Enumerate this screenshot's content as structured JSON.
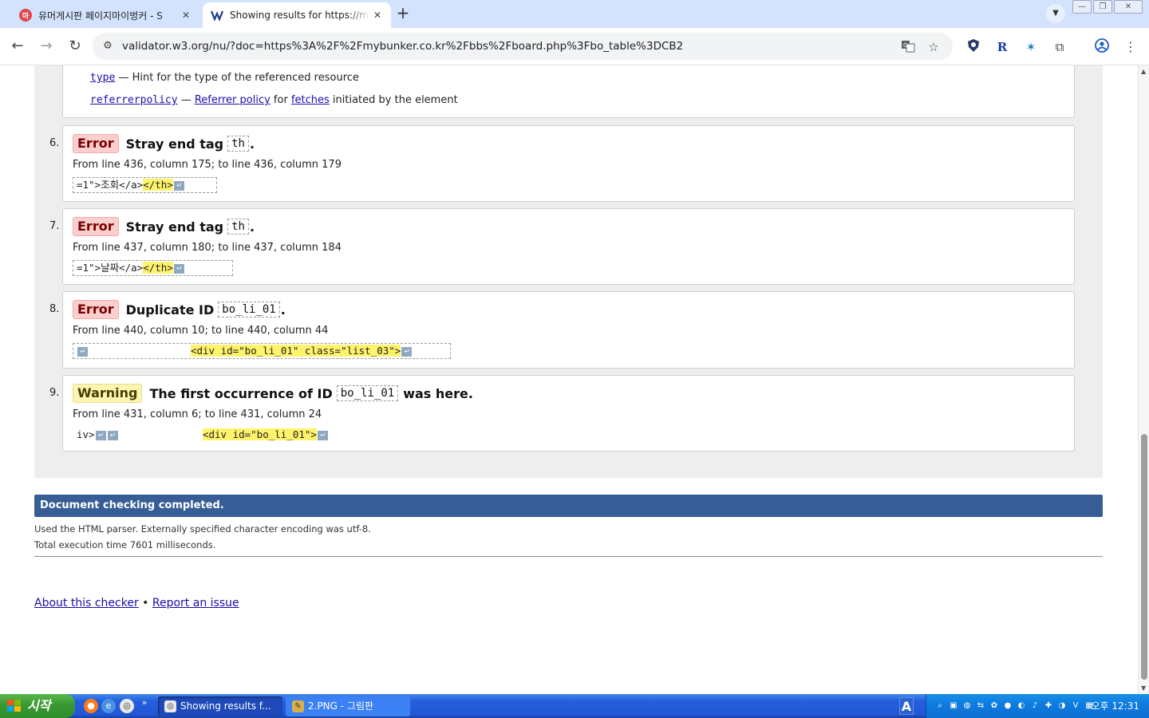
{
  "browser": {
    "tabs": [
      {
        "title": "유머게시판 페이지마이벙커 - S",
        "favicon": "마"
      },
      {
        "title": "Showing results for https://my",
        "favicon": "W3"
      }
    ],
    "url": "validator.w3.org/nu/?doc=https%3A%2F%2Fmybunker.co.kr%2Fbbs%2Fboard.php%3Fbo_table%3DCB2"
  },
  "partial_message": {
    "attr_type": "type",
    "attr_type_desc": " — Hint for the type of the referenced resource",
    "attr_referrerpolicy": "referrerpolicy",
    "dash": " — ",
    "referrer_policy_link": "Referrer policy",
    "for": " for ",
    "fetches_link": "fetches",
    "tail": " initiated by the element"
  },
  "messages": [
    {
      "num": "6.",
      "type": "Error",
      "text": "Stray end tag",
      "code": "th",
      "after": ".",
      "location": "From line 436, column 175; to line 436, column 179",
      "extract_pre": "=1\">조회</a>",
      "extract_hl": "</th>",
      "extract_post": "",
      "lf_symbol": "↩"
    },
    {
      "num": "7.",
      "type": "Error",
      "text": "Stray end tag",
      "code": "th",
      "after": ".",
      "location": "From line 437, column 180; to line 437, column 184",
      "extract_pre": "=1\">날짜</a>",
      "extract_hl": "</th>",
      "extract_post": "",
      "lf_symbol": "↩"
    },
    {
      "num": "8.",
      "type": "Error",
      "text": "Duplicate ID",
      "code": "bo_li_01",
      "after": ".",
      "location": "From line 440, column 10; to line 440, column 44",
      "extract_pre": "                 ",
      "extract_hl": "<div id=\"bo_li_01\" class=\"list_03\">",
      "extract_post": "",
      "lf_symbol": "↩"
    },
    {
      "num": "9.",
      "type": "Warning",
      "text": "The first occurrence of ID",
      "code": "bo_li_01",
      "after": "was here.",
      "location": "From line 431, column 6; to line 431, column 24",
      "extract_pre": "iv>",
      "extract_hl": "<div id=\"bo_li_01\">",
      "extract_post": "",
      "lf_symbol": "↩"
    }
  ],
  "completion": {
    "title": "Document checking completed.",
    "parser_note": "Used the HTML parser. Externally specified character encoding was utf-8.",
    "exec_time": "Total execution time 7601 milliseconds."
  },
  "footer": {
    "about": "About this checker",
    "separator": " • ",
    "report": "Report an issue"
  },
  "taskbar": {
    "start": "시작",
    "tasks": [
      {
        "label": "Showing results f..."
      },
      {
        "label": "2.PNG - 그림판"
      }
    ],
    "lang_indicator": "A",
    "clock": "오후 12:31"
  }
}
